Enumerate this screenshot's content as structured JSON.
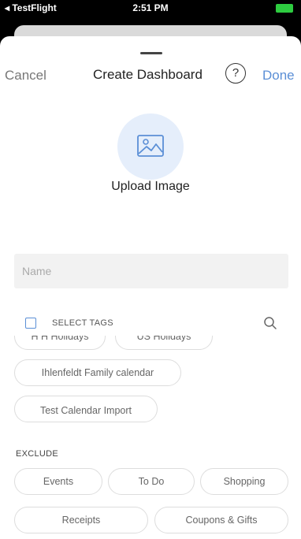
{
  "status_bar": {
    "back_label": "◂ TestFlight",
    "time": "2:51 PM"
  },
  "nav": {
    "cancel": "Cancel",
    "title": "Create Dashboard",
    "help": "?",
    "done": "Done"
  },
  "upload": {
    "label": "Upload Image"
  },
  "name_field": {
    "placeholder": "Name",
    "value": ""
  },
  "tags": {
    "select_label": "SELECT TAGS",
    "items": [
      "H H Holidays",
      "US Holidays",
      "Ihlenfeldt Family calendar",
      "Test Calendar Import"
    ]
  },
  "exclude": {
    "label": "EXCLUDE",
    "items": [
      "Events",
      "To Do",
      "Shopping",
      "Receipts",
      "Coupons & Gifts"
    ]
  },
  "colors": {
    "accent": "#5b8fd6",
    "upload_bg": "#e5eefb",
    "field_bg": "#f2f2f2"
  }
}
